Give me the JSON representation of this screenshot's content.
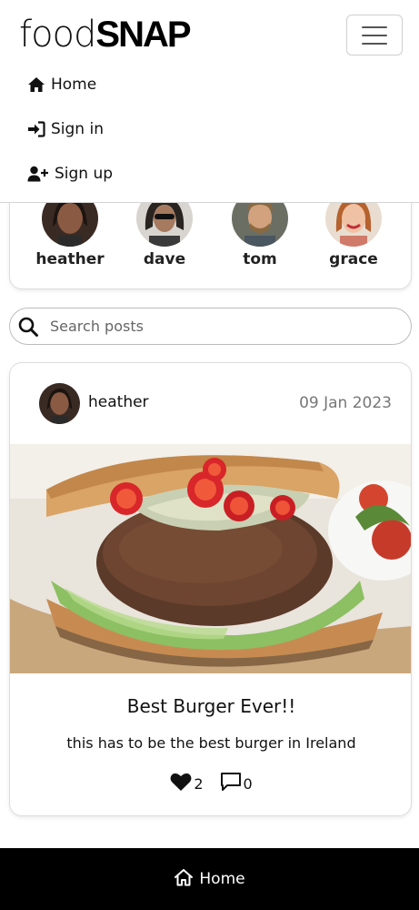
{
  "brand": {
    "light": "food",
    "bold": "SNAP"
  },
  "nav": {
    "items": [
      {
        "label": "Home",
        "icon": "home-icon"
      },
      {
        "label": "Sign in",
        "icon": "sign-in-icon"
      },
      {
        "label": "Sign up",
        "icon": "user-plus-icon"
      }
    ]
  },
  "profiles": [
    {
      "name": "heather"
    },
    {
      "name": "dave"
    },
    {
      "name": "tom"
    },
    {
      "name": "grace"
    }
  ],
  "search": {
    "placeholder": "Search posts",
    "value": ""
  },
  "post": {
    "author": "heather",
    "date": "09 Jan 2023",
    "title": "Best Burger Ever!!",
    "content": "this has to be the best burger in Ireland",
    "likes": "2",
    "comments": "0"
  },
  "footer": {
    "home_label": "Home"
  },
  "colors": {
    "footer_bg": "#000000",
    "date_text": "#777777",
    "card_border": "#dcdcdc"
  }
}
